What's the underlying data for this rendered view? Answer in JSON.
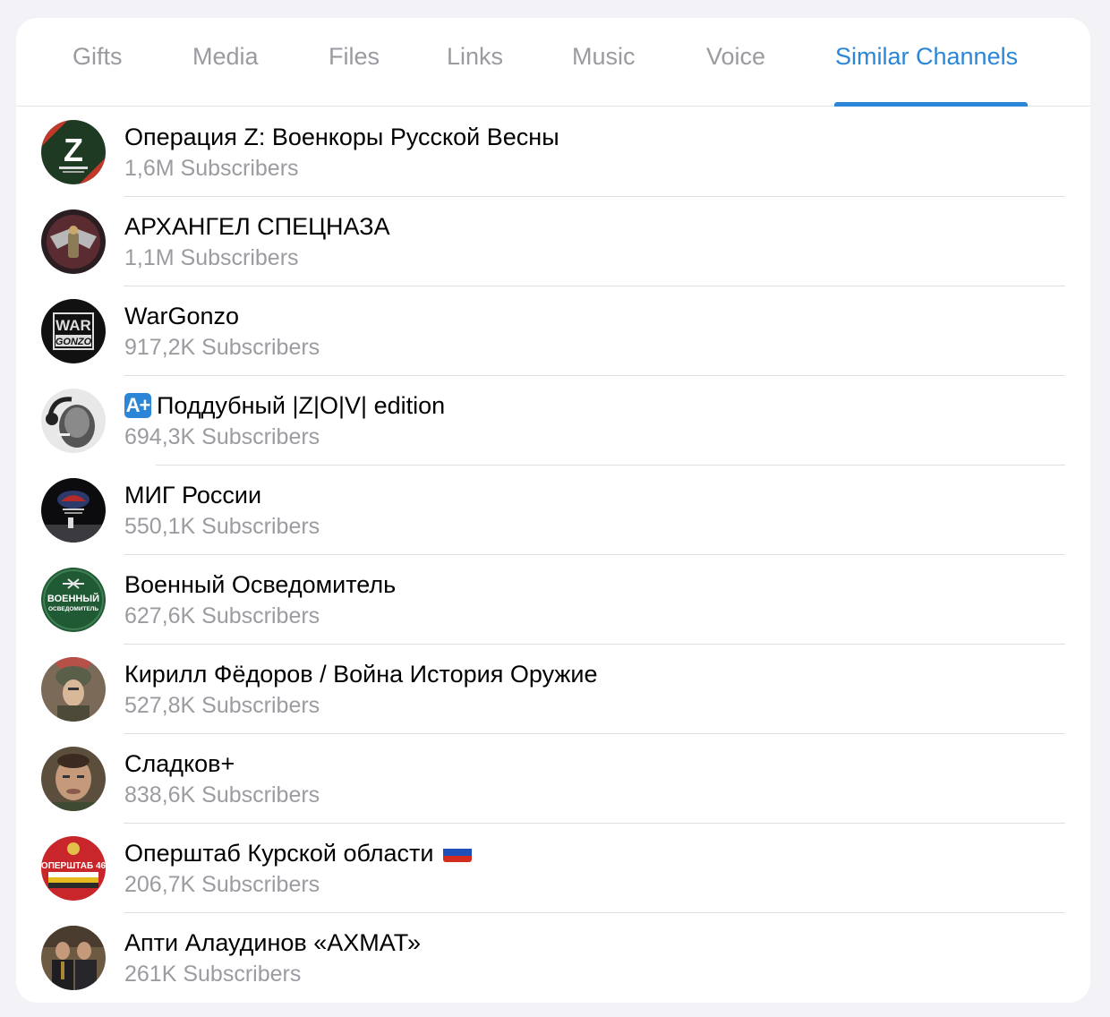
{
  "tabs": [
    {
      "label": "Gifts",
      "active": false
    },
    {
      "label": "Media",
      "active": false
    },
    {
      "label": "Files",
      "active": false
    },
    {
      "label": "Links",
      "active": false
    },
    {
      "label": "Music",
      "active": false
    },
    {
      "label": "Voice",
      "active": false
    },
    {
      "label": "Similar Channels",
      "active": true
    }
  ],
  "channels": [
    {
      "title": "Операция Z: Военкоры Русской Весны",
      "subscribers": "1,6M Subscribers",
      "avatar_icon": "z-logo-avatar"
    },
    {
      "title": "АРХАНГЕЛ СПЕЦНАЗА",
      "subscribers": "1,1M Subscribers",
      "avatar_icon": "winged-emblem-avatar"
    },
    {
      "title": "WarGonzo",
      "subscribers": "917,2K Subscribers",
      "avatar_icon": "war-gonzo-logo-avatar",
      "avatar_text": [
        "WAR",
        "GONZO"
      ]
    },
    {
      "title": "Поддубный |Z|O|V| edition",
      "subscribers": "694,3K Subscribers",
      "avatar_icon": "portrait-photo-avatar",
      "badge": "A+"
    },
    {
      "title": "МИГ России",
      "subscribers": "550,1K Subscribers",
      "avatar_icon": "mig-logo-avatar"
    },
    {
      "title": "Военный Осведомитель",
      "subscribers": "627,6K Subscribers",
      "avatar_icon": "voenny-osvedomitel-logo-avatar",
      "avatar_text": [
        "ВОЕННЫЙ",
        "ОСВЕДОМИТЕЛЬ"
      ]
    },
    {
      "title": "Кирилл Фёдоров / Война История Оружие",
      "subscribers": "527,8K Subscribers",
      "avatar_icon": "painted-portrait-avatar"
    },
    {
      "title": "Сладков+",
      "subscribers": "838,6K Subscribers",
      "avatar_icon": "portrait-photo-avatar"
    },
    {
      "title": "Оперштаб Курской области",
      "subscribers": "206,7K Subscribers",
      "avatar_icon": "operstab-logo-avatar",
      "avatar_text": [
        "ОПЕРШТАБ 46"
      ],
      "flag": "russian-flag-icon"
    },
    {
      "title": "Апти Алаудинов «АХМАТ»",
      "subscribers": "261K Subscribers",
      "avatar_icon": "group-photo-avatar"
    }
  ],
  "colors": {
    "accent": "#2b86d8",
    "muted_text": "#9b9ba1",
    "background": "#f2f2f7"
  }
}
